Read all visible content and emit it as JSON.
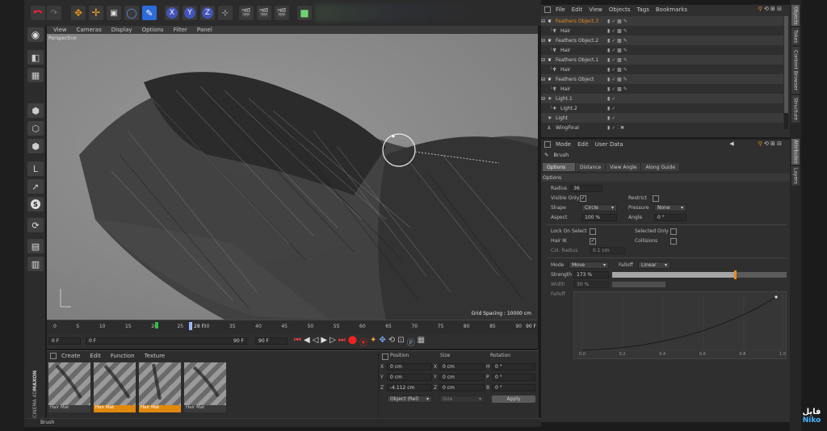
{
  "viewport": {
    "menu": [
      "View",
      "Cameras",
      "Display",
      "Options",
      "Filter",
      "Panel"
    ],
    "label": "Perspective",
    "grid_spacing": "Grid Spacing : 10000 cm"
  },
  "timeline": {
    "ticks": [
      "0",
      "5",
      "10",
      "15",
      "20",
      "25",
      "30",
      "35",
      "40",
      "45",
      "50",
      "55",
      "60",
      "65",
      "70",
      "75",
      "80",
      "85",
      "90"
    ],
    "current_frame_marker": "28 F",
    "end_frame": "90 F",
    "start_field": "0 F",
    "range_start": "0 F",
    "range_end": "90 F",
    "end_field": "90 F"
  },
  "materials": {
    "menu": [
      "Create",
      "Edit",
      "Function",
      "Texture"
    ],
    "items": [
      "Hair Mat",
      "Hair Mat",
      "Hair Mat",
      "Hair Mat"
    ]
  },
  "coordinates": {
    "headers": [
      "Position",
      "Size",
      "Rotation"
    ],
    "rows": [
      {
        "axis": "X",
        "pos": "0 cm",
        "saxis": "X",
        "size": "0 cm",
        "raxis": "H",
        "rot": "0 °"
      },
      {
        "axis": "Y",
        "pos": "0 cm",
        "saxis": "Y",
        "size": "0 cm",
        "raxis": "P",
        "rot": "0 °"
      },
      {
        "axis": "Z",
        "pos": "-4.112 cm",
        "saxis": "Z",
        "size": "0 cm",
        "raxis": "B",
        "rot": "0 °"
      }
    ],
    "mode_dropdown": "Object (Rel)",
    "size_dropdown": "Size",
    "apply_label": "Apply"
  },
  "status": "Brush",
  "object_manager": {
    "menu": [
      "File",
      "Edit",
      "View",
      "Objects",
      "Tags",
      "Bookmarks"
    ],
    "objects": [
      {
        "name": "Feathers Object.3",
        "indent": 0
      },
      {
        "name": "Hair",
        "indent": 1
      },
      {
        "name": "Feathers Object.2",
        "indent": 0
      },
      {
        "name": "Hair",
        "indent": 1
      },
      {
        "name": "Feathers Object.1",
        "indent": 0
      },
      {
        "name": "Hair",
        "indent": 1
      },
      {
        "name": "Feathers Object",
        "indent": 0
      },
      {
        "name": "Hair",
        "indent": 1
      },
      {
        "name": "Light.1",
        "indent": 0
      },
      {
        "name": "Light.2",
        "indent": 1
      },
      {
        "name": "Light",
        "indent": 0
      },
      {
        "name": "WingFinal",
        "indent": 0
      }
    ]
  },
  "attributes": {
    "menu": [
      "Mode",
      "Edit",
      "User Data"
    ],
    "tool_name": "Brush",
    "tabs": [
      "Options",
      "Distance",
      "View Angle",
      "Along Guide"
    ],
    "section": "Options",
    "radius_label": "Radius",
    "radius_value": "36",
    "visible_only_label": "Visible Only",
    "restrict_label": "Restrict",
    "shape_label": "Shape",
    "shape_value": "Circle",
    "pressure_label": "Pressure",
    "pressure_value": "None",
    "aspect_label": "Aspect",
    "aspect_value": "100 %",
    "angle_label": "Angle",
    "angle_value": "0 °",
    "lock_on_select_label": "Lock On Select",
    "selected_only_label": "Selected Only",
    "hair_ik_label": "Hair IK",
    "collisions_label": "Collisions",
    "col_radius_label": "Col. Radius",
    "col_radius_value": "0.1 cm",
    "mode_label": "Mode",
    "mode_value": "Move",
    "falloff_label": "Falloff",
    "falloff_value": "Linear",
    "strength_label": "Strength",
    "strength_value": "173 %",
    "strength_fraction": 0.7,
    "width_label": "Width",
    "width_value": "30 %",
    "falloff_curve_label": "Falloff",
    "graph_ticks": [
      "0.0",
      "0.2",
      "0.4",
      "0.6",
      "0.8",
      "1.0"
    ]
  },
  "right_tabs": [
    "Objects",
    "Takes",
    "Content Browser",
    "Structure"
  ],
  "right_tabs2": [
    "Attributes",
    "Layers"
  ],
  "branding": {
    "maxon": "MAXON",
    "c4d": "CINEMA 4D"
  },
  "watermark": {
    "line1": "فایل",
    "line2": "Niko"
  },
  "colors": {
    "accent_blue": "#2c6bd8",
    "orange": "#e88b1a",
    "viewport_bg": "#8a8a8a"
  }
}
